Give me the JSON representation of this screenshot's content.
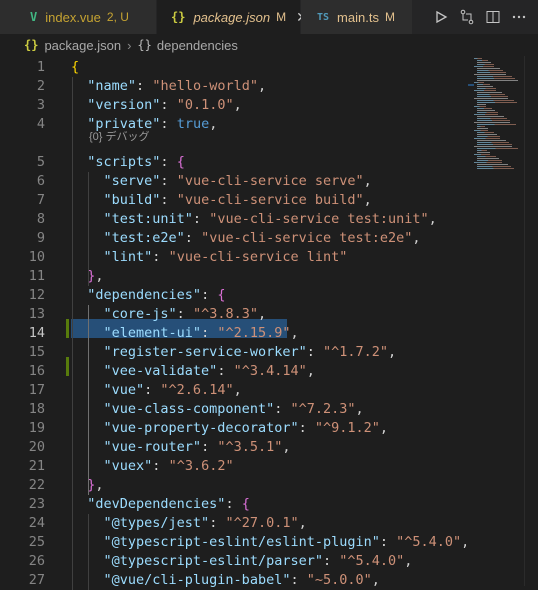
{
  "tabs": [
    {
      "icon": "V",
      "label": "index.vue",
      "status": "2, U",
      "status_color": "#c5a332"
    },
    {
      "icon": "{}",
      "label": "package.json",
      "status": "M",
      "status_color": "#e2c08d"
    },
    {
      "icon": "TS",
      "label": "main.ts",
      "status": "M",
      "status_color": "#e2c08d"
    }
  ],
  "breadcrumb": {
    "file": "package.json",
    "symbol": "dependencies"
  },
  "codelens": {
    "label": "{0} デバッグ"
  },
  "editor": {
    "current_line": 14,
    "selected_text": "\"element-ui\": \"^2.15.9\",",
    "lines": [
      {
        "n": "1",
        "t": [
          [
            "b1",
            "{"
          ]
        ]
      },
      {
        "n": "2",
        "t": [
          [
            "p",
            "  "
          ],
          [
            "k",
            "\"name\""
          ],
          [
            "p",
            ": "
          ],
          [
            "s",
            "\"hello-world\""
          ],
          [
            "p",
            ","
          ]
        ]
      },
      {
        "n": "3",
        "t": [
          [
            "p",
            "  "
          ],
          [
            "k",
            "\"version\""
          ],
          [
            "p",
            ": "
          ],
          [
            "s",
            "\"0.1.0\""
          ],
          [
            "p",
            ","
          ]
        ]
      },
      {
        "n": "4",
        "t": [
          [
            "p",
            "  "
          ],
          [
            "k",
            "\"private\""
          ],
          [
            "p",
            ": "
          ],
          [
            "kw",
            "true"
          ],
          [
            "p",
            ","
          ]
        ]
      },
      {
        "n": "5",
        "t": [
          [
            "p",
            "  "
          ],
          [
            "k",
            "\"scripts\""
          ],
          [
            "p",
            ": "
          ],
          [
            "b2",
            "{"
          ]
        ]
      },
      {
        "n": "6",
        "t": [
          [
            "p",
            "    "
          ],
          [
            "k",
            "\"serve\""
          ],
          [
            "p",
            ": "
          ],
          [
            "s",
            "\"vue-cli-service serve\""
          ],
          [
            "p",
            ","
          ]
        ]
      },
      {
        "n": "7",
        "t": [
          [
            "p",
            "    "
          ],
          [
            "k",
            "\"build\""
          ],
          [
            "p",
            ": "
          ],
          [
            "s",
            "\"vue-cli-service build\""
          ],
          [
            "p",
            ","
          ]
        ]
      },
      {
        "n": "8",
        "t": [
          [
            "p",
            "    "
          ],
          [
            "k",
            "\"test:unit\""
          ],
          [
            "p",
            ": "
          ],
          [
            "s",
            "\"vue-cli-service test:unit\""
          ],
          [
            "p",
            ","
          ]
        ]
      },
      {
        "n": "9",
        "t": [
          [
            "p",
            "    "
          ],
          [
            "k",
            "\"test:e2e\""
          ],
          [
            "p",
            ": "
          ],
          [
            "s",
            "\"vue-cli-service test:e2e\""
          ],
          [
            "p",
            ","
          ]
        ]
      },
      {
        "n": "10",
        "t": [
          [
            "p",
            "    "
          ],
          [
            "k",
            "\"lint\""
          ],
          [
            "p",
            ": "
          ],
          [
            "s",
            "\"vue-cli-service lint\""
          ]
        ]
      },
      {
        "n": "11",
        "t": [
          [
            "p",
            "  "
          ],
          [
            "b2",
            "}"
          ],
          [
            "p",
            ","
          ]
        ]
      },
      {
        "n": "12",
        "t": [
          [
            "p",
            "  "
          ],
          [
            "k",
            "\"dependencies\""
          ],
          [
            "p",
            ": "
          ],
          [
            "b2",
            "{"
          ]
        ]
      },
      {
        "n": "13",
        "t": [
          [
            "p",
            "    "
          ],
          [
            "k",
            "\"core-js\""
          ],
          [
            "p",
            ": "
          ],
          [
            "s",
            "\"^3.8.3\""
          ],
          [
            "p",
            ","
          ]
        ]
      },
      {
        "n": "14",
        "t": [
          [
            "p",
            "    "
          ],
          [
            "k",
            "\"element-ui\""
          ],
          [
            "p",
            ": "
          ],
          [
            "s",
            "\"^2.15.9\""
          ],
          [
            "p",
            ","
          ]
        ]
      },
      {
        "n": "15",
        "t": [
          [
            "p",
            "    "
          ],
          [
            "k",
            "\"register-service-worker\""
          ],
          [
            "p",
            ": "
          ],
          [
            "s",
            "\"^1.7.2\""
          ],
          [
            "p",
            ","
          ]
        ]
      },
      {
        "n": "16",
        "t": [
          [
            "p",
            "    "
          ],
          [
            "k",
            "\"vee-validate\""
          ],
          [
            "p",
            ": "
          ],
          [
            "s",
            "\"^3.4.14\""
          ],
          [
            "p",
            ","
          ]
        ]
      },
      {
        "n": "17",
        "t": [
          [
            "p",
            "    "
          ],
          [
            "k",
            "\"vue\""
          ],
          [
            "p",
            ": "
          ],
          [
            "s",
            "\"^2.6.14\""
          ],
          [
            "p",
            ","
          ]
        ]
      },
      {
        "n": "18",
        "t": [
          [
            "p",
            "    "
          ],
          [
            "k",
            "\"vue-class-component\""
          ],
          [
            "p",
            ": "
          ],
          [
            "s",
            "\"^7.2.3\""
          ],
          [
            "p",
            ","
          ]
        ]
      },
      {
        "n": "19",
        "t": [
          [
            "p",
            "    "
          ],
          [
            "k",
            "\"vue-property-decorator\""
          ],
          [
            "p",
            ": "
          ],
          [
            "s",
            "\"^9.1.2\""
          ],
          [
            "p",
            ","
          ]
        ]
      },
      {
        "n": "20",
        "t": [
          [
            "p",
            "    "
          ],
          [
            "k",
            "\"vue-router\""
          ],
          [
            "p",
            ": "
          ],
          [
            "s",
            "\"^3.5.1\""
          ],
          [
            "p",
            ","
          ]
        ]
      },
      {
        "n": "21",
        "t": [
          [
            "p",
            "    "
          ],
          [
            "k",
            "\"vuex\""
          ],
          [
            "p",
            ": "
          ],
          [
            "s",
            "\"^3.6.2\""
          ]
        ]
      },
      {
        "n": "22",
        "t": [
          [
            "p",
            "  "
          ],
          [
            "b2",
            "}"
          ],
          [
            "p",
            ","
          ]
        ]
      },
      {
        "n": "23",
        "t": [
          [
            "p",
            "  "
          ],
          [
            "k",
            "\"devDependencies\""
          ],
          [
            "p",
            ": "
          ],
          [
            "b2",
            "{"
          ]
        ]
      },
      {
        "n": "24",
        "t": [
          [
            "p",
            "    "
          ],
          [
            "k",
            "\"@types/jest\""
          ],
          [
            "p",
            ": "
          ],
          [
            "s",
            "\"^27.0.1\""
          ],
          [
            "p",
            ","
          ]
        ]
      },
      {
        "n": "25",
        "t": [
          [
            "p",
            "    "
          ],
          [
            "k",
            "\"@typescript-eslint/eslint-plugin\""
          ],
          [
            "p",
            ": "
          ],
          [
            "s",
            "\"^5.4.0\""
          ],
          [
            "p",
            ","
          ]
        ]
      },
      {
        "n": "26",
        "t": [
          [
            "p",
            "    "
          ],
          [
            "k",
            "\"@typescript-eslint/parser\""
          ],
          [
            "p",
            ": "
          ],
          [
            "s",
            "\"^5.4.0\""
          ],
          [
            "p",
            ","
          ]
        ]
      },
      {
        "n": "27",
        "t": [
          [
            "p",
            "    "
          ],
          [
            "k",
            "\"@vue/cli-plugin-babel\""
          ],
          [
            "p",
            ": "
          ],
          [
            "s",
            "\"~5.0.0\""
          ],
          [
            "p",
            ","
          ]
        ]
      }
    ]
  },
  "actions": [
    {
      "name": "run-icon",
      "glyph": "▷"
    },
    {
      "name": "source-control-compare-icon",
      "glyph": "⇄"
    },
    {
      "name": "split-editor-icon",
      "glyph": "◫"
    },
    {
      "name": "more-actions-icon",
      "glyph": "⋯"
    }
  ],
  "colors": {
    "vue_icon": "#41b883",
    "json_icon": "#cbcb41",
    "ts_icon": "#519aba",
    "selection": "#264f78",
    "modified_gutter": "#587c0c"
  }
}
